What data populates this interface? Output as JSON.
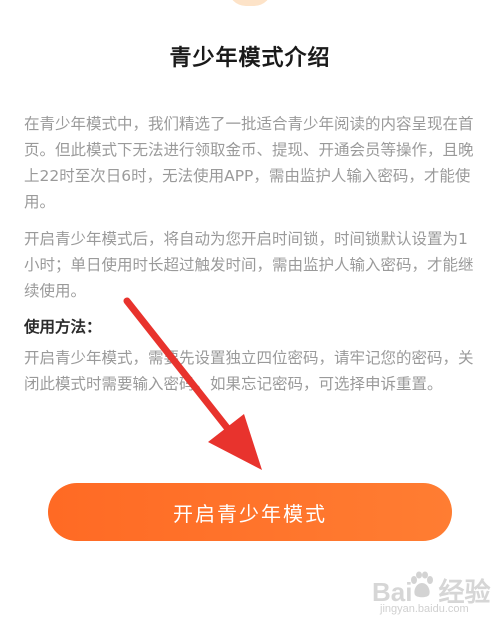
{
  "title": "青少年模式介绍",
  "paragraphs": [
    "在青少年模式中，我们精选了一批适合青少年阅读的内容呈现在首页。但此模式下无法进行领取金币、提现、开通会员等操作，且晚上22时至次日6时，无法使用APP，需由监护人输入密码，才能使用。",
    "开启青少年模式后，将自动为您开启时间锁，时间锁默认设置为1小时；单日使用时长超过触发时间，需由监护人输入密码，才能继续使用。"
  ],
  "usage": {
    "heading": "使用方法：",
    "text": "开启青少年模式，需要先设置独立四位密码，请牢记您的密码，关闭此模式时需要输入密码。如果忘记密码，可选择申诉重置。"
  },
  "button": {
    "label": "开启青少年模式"
  },
  "watermark": {
    "brand": "Bai",
    "suffix": "经验",
    "url": "jingyan.baidu.com"
  },
  "colors": {
    "accent": "#ff6a24",
    "arrow": "#e8332d",
    "text_muted": "#9a9a9a"
  }
}
